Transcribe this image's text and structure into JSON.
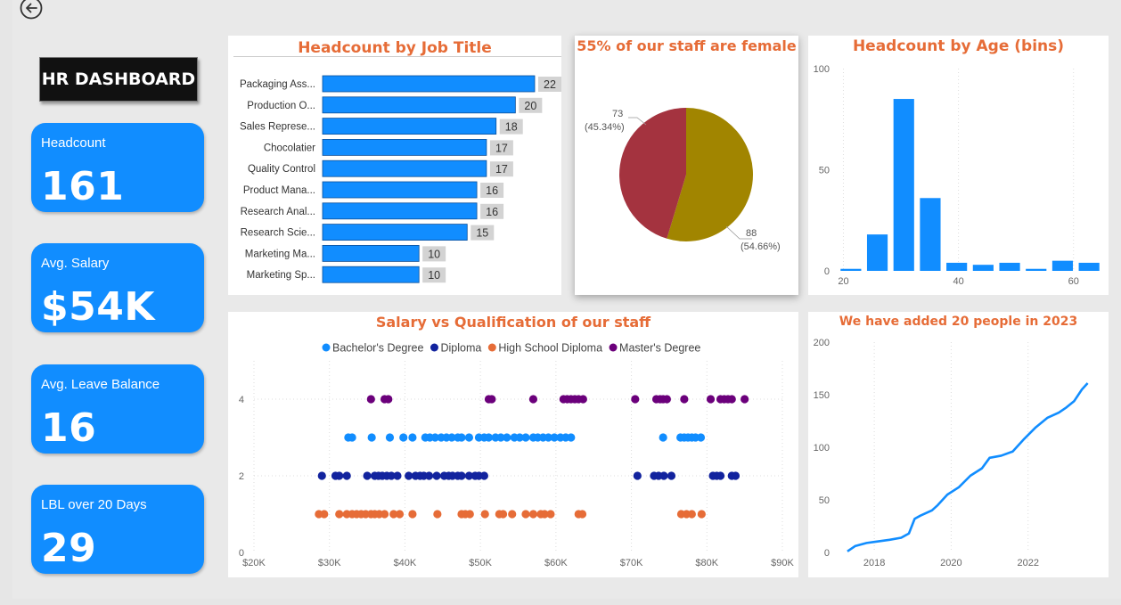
{
  "dashboard": {
    "title": "HR DASHBOARD"
  },
  "kpis": [
    {
      "label": "Headcount",
      "value": "161"
    },
    {
      "label": "Avg. Salary",
      "value": "$54K"
    },
    {
      "label": "Avg. Leave Balance",
      "value": "16"
    },
    {
      "label": "LBL over 20 Days",
      "value": "29"
    }
  ],
  "colors": {
    "accent_blue": "#118dff",
    "title_orange": "#e66c37",
    "pie_female": "#a18500",
    "pie_male": "#a4333f",
    "series_bachelor": "#118dff",
    "series_diploma": "#12239e",
    "series_highschool": "#e66c37",
    "series_master": "#6b007b"
  },
  "icons": {
    "back": "back-arrow-circle-icon"
  },
  "charts": {
    "job_title": {
      "title": "Headcount by Job Title"
    },
    "gender": {
      "title": "55% of our staff are female",
      "male_label": "73",
      "male_pct": "(45.34%)",
      "female_label": "88",
      "female_pct": "(54.66%)"
    },
    "age": {
      "title": "Headcount by Age (bins)"
    },
    "salary": {
      "title": "Salary vs Qualification of our staff"
    },
    "growth": {
      "title": "We have added 20 people in 2023"
    }
  },
  "chart_data": [
    {
      "type": "bar",
      "orientation": "horizontal",
      "title": "Headcount by Job Title",
      "categories": [
        "Packaging Ass...",
        "Production O...",
        "Sales Represe...",
        "Chocolatier",
        "Quality Control",
        "Product Mana...",
        "Research Anal...",
        "Research Scie...",
        "Marketing Ma...",
        "Marketing Sp..."
      ],
      "values": [
        22,
        20,
        18,
        17,
        17,
        16,
        16,
        15,
        10,
        10
      ],
      "xlim": [
        0,
        22
      ]
    },
    {
      "type": "pie",
      "title": "55% of our staff are female",
      "slices": [
        {
          "value": 88,
          "label": "88",
          "pct": "(54.66%)",
          "color": "#a18500"
        },
        {
          "value": 73,
          "label": "73",
          "pct": "(45.34%)",
          "color": "#a4333f"
        }
      ]
    },
    {
      "type": "bar",
      "title": "Headcount by Age (bins)",
      "x": [
        20,
        23,
        28,
        33,
        38,
        43,
        48,
        53,
        58,
        63
      ],
      "values": [
        1,
        18,
        85,
        36,
        4,
        3,
        4,
        1,
        5,
        4
      ],
      "xlim": [
        19,
        65
      ],
      "ylim": [
        0,
        100
      ],
      "xticks": [
        20,
        40,
        60
      ],
      "yticks": [
        0,
        50,
        100
      ],
      "color": "#118dff"
    },
    {
      "type": "scatter",
      "title": "Salary vs Qualification of our staff",
      "xlim": [
        20000,
        90000
      ],
      "ylim": [
        0,
        5
      ],
      "xticks": [
        "$20K",
        "$30K",
        "$40K",
        "$50K",
        "$60K",
        "$70K",
        "$80K",
        "$90K"
      ],
      "yticks": [
        0,
        2,
        4
      ],
      "legend": "top",
      "series": [
        {
          "name": "Bachelor's Degree",
          "color": "#118dff",
          "y": 3,
          "x": [
            32500,
            33000,
            35600,
            38000,
            39800,
            41000,
            42700,
            43300,
            44000,
            44800,
            45500,
            46200,
            47000,
            47500,
            48500,
            49800,
            50500,
            51100,
            52000,
            52700,
            53500,
            54500,
            55200,
            56000,
            57000,
            57600,
            58300,
            59000,
            59800,
            60600,
            61300,
            62000,
            74200,
            76500,
            77000,
            77500,
            78000,
            78500,
            79200
          ]
        },
        {
          "name": "Diploma",
          "color": "#12239e",
          "y": 2,
          "x": [
            29000,
            30800,
            31300,
            32300,
            35000,
            36000,
            36500,
            37000,
            37600,
            38200,
            39000,
            40500,
            41400,
            42000,
            42500,
            43200,
            44200,
            45200,
            45800,
            46300,
            47000,
            47500,
            48500,
            49300,
            49800,
            50500,
            70800,
            73000,
            73600,
            74300,
            75300,
            80800,
            81300,
            81800,
            83300,
            83800
          ]
        },
        {
          "name": "High School Diploma",
          "color": "#e66c37",
          "y": 1,
          "x": [
            28600,
            29300,
            31300,
            32300,
            33000,
            33600,
            34200,
            34800,
            35500,
            36000,
            36600,
            37300,
            38500,
            39300,
            41000,
            44300,
            47500,
            48000,
            48600,
            50600,
            52500,
            53000,
            54200,
            56000,
            57000,
            58000,
            58500,
            59300,
            63000,
            63500,
            76600,
            77300,
            78000,
            79300
          ]
        },
        {
          "name": "Master's Degree",
          "color": "#6b007b",
          "y": 4,
          "x": [
            35500,
            37300,
            37800,
            51100,
            51500,
            57000,
            61000,
            61500,
            62000,
            62500,
            63000,
            63600,
            70500,
            73300,
            73800,
            74200,
            74700,
            77000,
            80500,
            81800,
            82300,
            82800,
            83300,
            85000
          ]
        }
      ]
    },
    {
      "type": "line",
      "title": "We have added 20 people in 2023",
      "x": [
        2017.3,
        2017.5,
        2017.8,
        2018.0,
        2018.4,
        2018.7,
        2018.9,
        2019.05,
        2019.2,
        2019.5,
        2019.65,
        2019.9,
        2020.2,
        2020.5,
        2020.8,
        2021.0,
        2021.3,
        2021.6,
        2021.9,
        2022.2,
        2022.5,
        2022.8,
        2023.0,
        2023.2,
        2023.4,
        2023.55
      ],
      "y": [
        1,
        6,
        9,
        10,
        12,
        14,
        18,
        32,
        35,
        40,
        45,
        55,
        62,
        73,
        80,
        90,
        92,
        96,
        108,
        119,
        128,
        133,
        138,
        144,
        155,
        161
      ],
      "xlim": [
        2017,
        2024
      ],
      "ylim": [
        0,
        200
      ],
      "xticks": [
        2018,
        2020,
        2022
      ],
      "yticks": [
        0,
        50,
        100,
        150,
        200
      ],
      "color": "#118dff"
    }
  ]
}
